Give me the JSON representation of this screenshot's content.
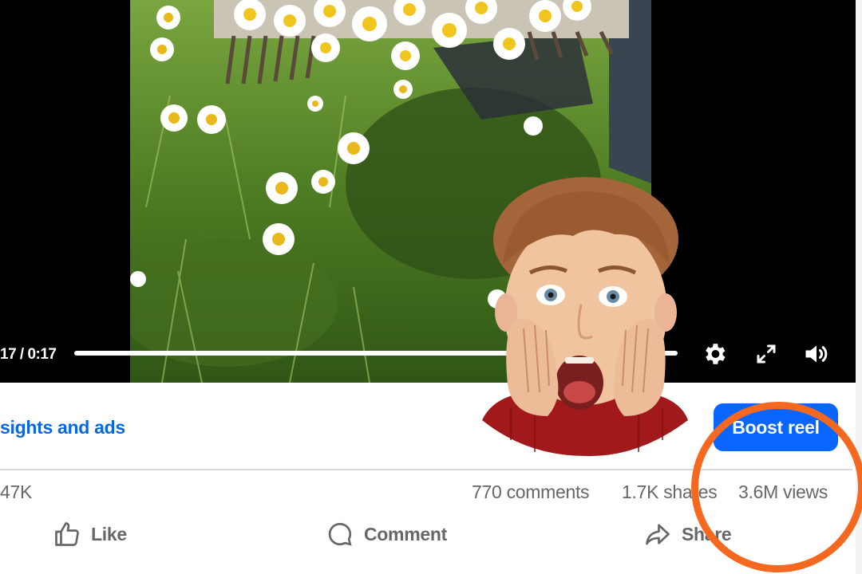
{
  "video": {
    "time": "17 / 0:17",
    "progress": 1.0
  },
  "controls": {
    "settings_icon": "gear-icon",
    "fullscreen_icon": "expand-icon",
    "volume_icon": "speaker-icon"
  },
  "actions_bar": {
    "insights_label": "sights and ads",
    "boost_label": "Boost reel"
  },
  "stats": {
    "reactions": "47K",
    "comments": "770 comments",
    "shares": "1.7K shares",
    "views": "3.6M views"
  },
  "buttons": {
    "like": "Like",
    "comment": "Comment",
    "share": "Share"
  },
  "colors": {
    "accent_blue": "#0866ff",
    "link_blue": "#0a66e4",
    "muted_text": "#65676b",
    "highlight_orange": "#f4691f"
  }
}
